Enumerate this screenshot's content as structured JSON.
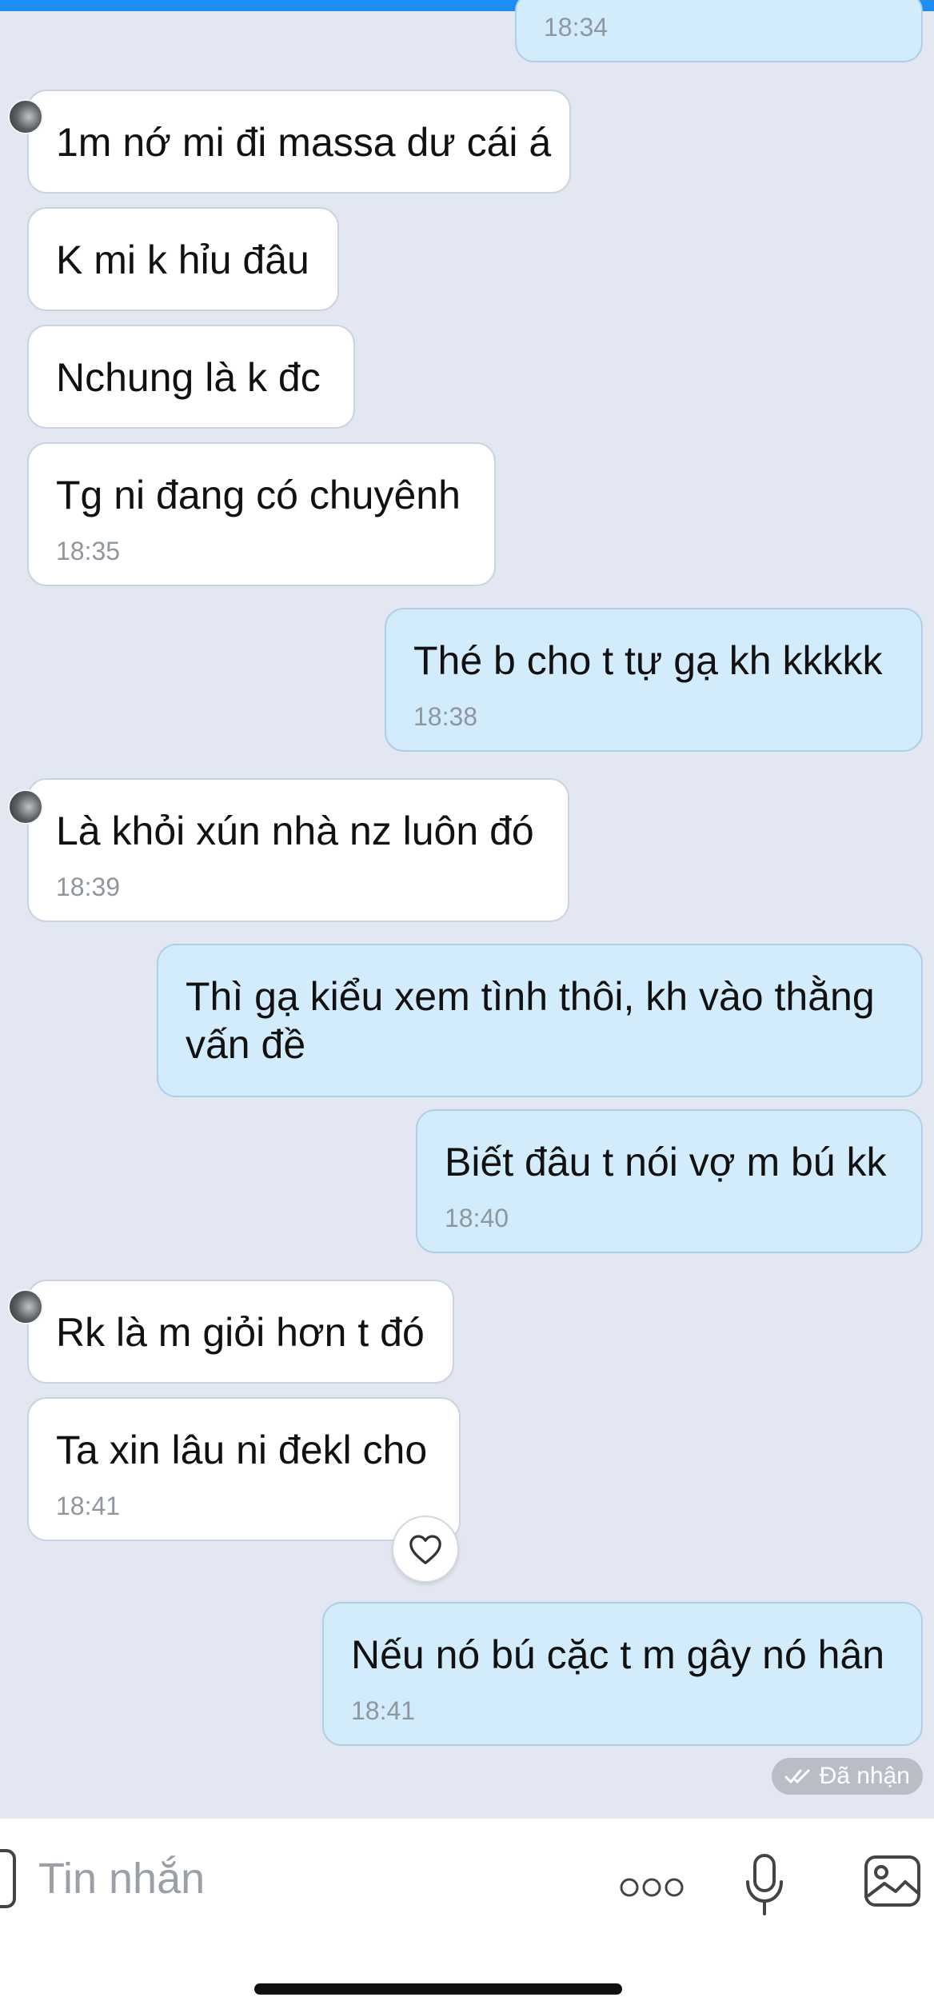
{
  "messages": {
    "m0": {
      "time": "18:34"
    },
    "m1": {
      "text": "1m nớ mi đi massa dư cái á"
    },
    "m2": {
      "text": "K mi k hỉu đâu"
    },
    "m3": {
      "text": "Nchung là k đc"
    },
    "m4": {
      "text": "Tg ni đang có chuyênh",
      "time": "18:35"
    },
    "m5": {
      "text": "Thé b cho t tự gạ kh kkkkk",
      "time": "18:38"
    },
    "m6": {
      "text": "Là khỏi xún nhà nz luôn đó",
      "time": "18:39"
    },
    "m7": {
      "text": "Thì gạ kiểu xem tình thôi, kh vào thằng vấn đề"
    },
    "m8": {
      "text": "Biết đâu t nói vợ m bú kk",
      "time": "18:40"
    },
    "m9": {
      "text": "Rk là m giỏi hơn t đó"
    },
    "m10": {
      "text": "Ta xin lâu ni đekl cho",
      "time": "18:41"
    },
    "m11": {
      "text": "Nếu nó bú cặc t m gây nó hân",
      "time": "18:41"
    }
  },
  "status": {
    "label": "Đã nhận",
    "icon": "double-check-icon"
  },
  "composer": {
    "placeholder": "Tin nhắn"
  },
  "icons": [
    "heart-icon",
    "more-icon",
    "microphone-icon",
    "image-icon"
  ],
  "colors": {
    "accent": "#1f8ef4",
    "outgoing": "#d3ecfc",
    "incoming": "#ffffff",
    "background": "#e2e7f1"
  }
}
